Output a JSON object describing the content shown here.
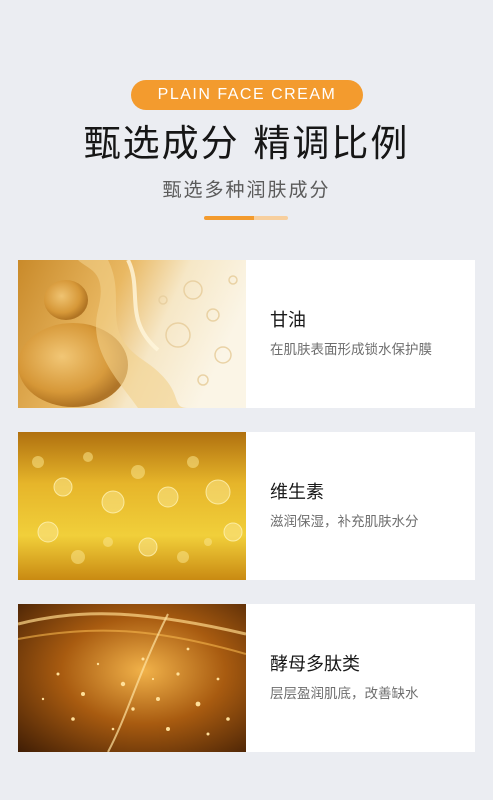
{
  "header": {
    "badge": "PLAIN FACE CREAM",
    "title": "甄选成分 精调比例",
    "subtitle": "甄选多种润肤成分"
  },
  "colors": {
    "accent": "#f39b2e",
    "accent_light": "#f7cf9e",
    "background": "#ebedf2"
  },
  "ingredients": [
    {
      "name": "甘油",
      "desc": "在肌肤表面形成锁水保护膜",
      "image": "golden-oil-droplets-image"
    },
    {
      "name": "维生素",
      "desc": "滋润保湿，补充肌肤水分",
      "image": "golden-bubbles-image"
    },
    {
      "name": "酵母多肽类",
      "desc": "层层盈润肌底，改善缺水",
      "image": "golden-sparkle-splash-image"
    }
  ]
}
